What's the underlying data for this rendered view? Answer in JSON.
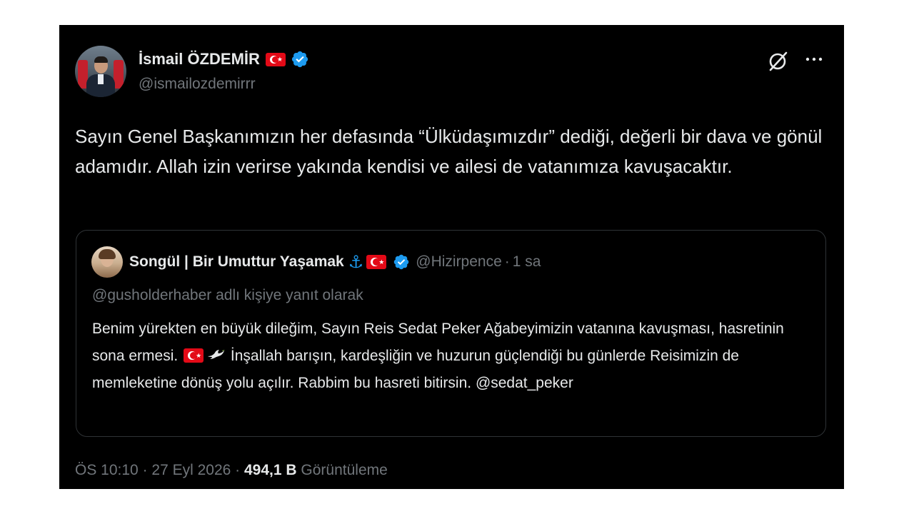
{
  "author": {
    "name": "İsmail ÖZDEMİR",
    "handle": "@ismailozdemirrr"
  },
  "tweet": {
    "text": "Sayın Genel Başkanımızın her defasında “Ülküdaşımızdır” dediği, değerli bir dava ve gönül adamıdır. Allah izin verirse yakında kendisi ve ailesi de vatanımıza kavuşacaktır."
  },
  "quote": {
    "name": "Songül | Bir Umuttur Yaşamak",
    "handle": "@Hizirpence",
    "time": "1 sa",
    "reply_to": "@gusholderhaber adlı kişiye yanıt olarak",
    "text_part1": "Benim yürekten en büyük dileğim, Sayın Reis Sedat Peker Ağabeyimizin vatanına kavuşması, hasretinin sona ermesi.",
    "text_part2": "İnşallah barışın, kardeşliğin ve huzurun güçlendiği bu günlerde Reisimizin de memleketine dönüş yolu açılır. Rabbim bu hasreti bitirsin.",
    "mention": "@sedat_peker"
  },
  "footer": {
    "time": "ÖS 10:10",
    "date": "27 Eyl 2026",
    "views_count": "494,1 B",
    "views_label": "Görüntüleme"
  },
  "icons": {
    "verified_badge": "verified-badge-icon",
    "grok": "grok-icon",
    "more": "more-icon",
    "anchor": "anchor-icon",
    "turkish_flag": "turkish-flag-icon",
    "dove": "dove-icon"
  },
  "colors": {
    "background": "#000000",
    "text": "#e7e9ea",
    "muted": "#71767b",
    "accent": "#1d9bf0",
    "border": "#2f3336",
    "flag_red": "#e30a17"
  }
}
